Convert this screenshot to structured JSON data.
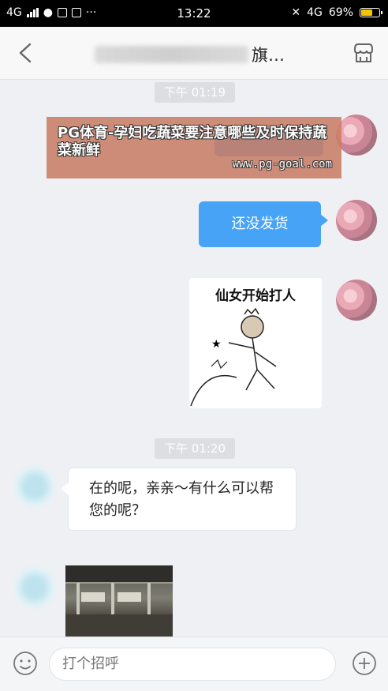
{
  "status_bar": {
    "network_left": "4G",
    "time": "13:22",
    "network_right": "4G",
    "battery": "69%",
    "battery_level": 0.69,
    "icons": [
      "signal-icon",
      "wechat-icon",
      "notification-icon",
      "gallery-icon",
      "more-icon",
      "mute-icon",
      "battery-icon"
    ]
  },
  "header": {
    "title_suffix": "旗…",
    "back_icon": "chevron-left-icon",
    "shop_icon": "shop-icon"
  },
  "messages": {
    "time_1": "下午 01:19",
    "msg_1": "还没发货",
    "sticker_text": "仙女开始打人",
    "time_2": "下午 01:20",
    "reply": "在的呢，亲亲～有什么可以帮您的呢？"
  },
  "banner": {
    "title": "PG体育-孕妇吃蔬菜要注意哪些及时保持蔬菜新鲜",
    "url": "www.pg-goal.com"
  },
  "input_bar": {
    "placeholder": "打个招呼",
    "emoji_icon": "emoji-icon",
    "plus_icon": "plus-icon"
  },
  "colors": {
    "accent_blue": "#46a3f5",
    "banner": "#c87d67",
    "background": "#eef0f4"
  }
}
